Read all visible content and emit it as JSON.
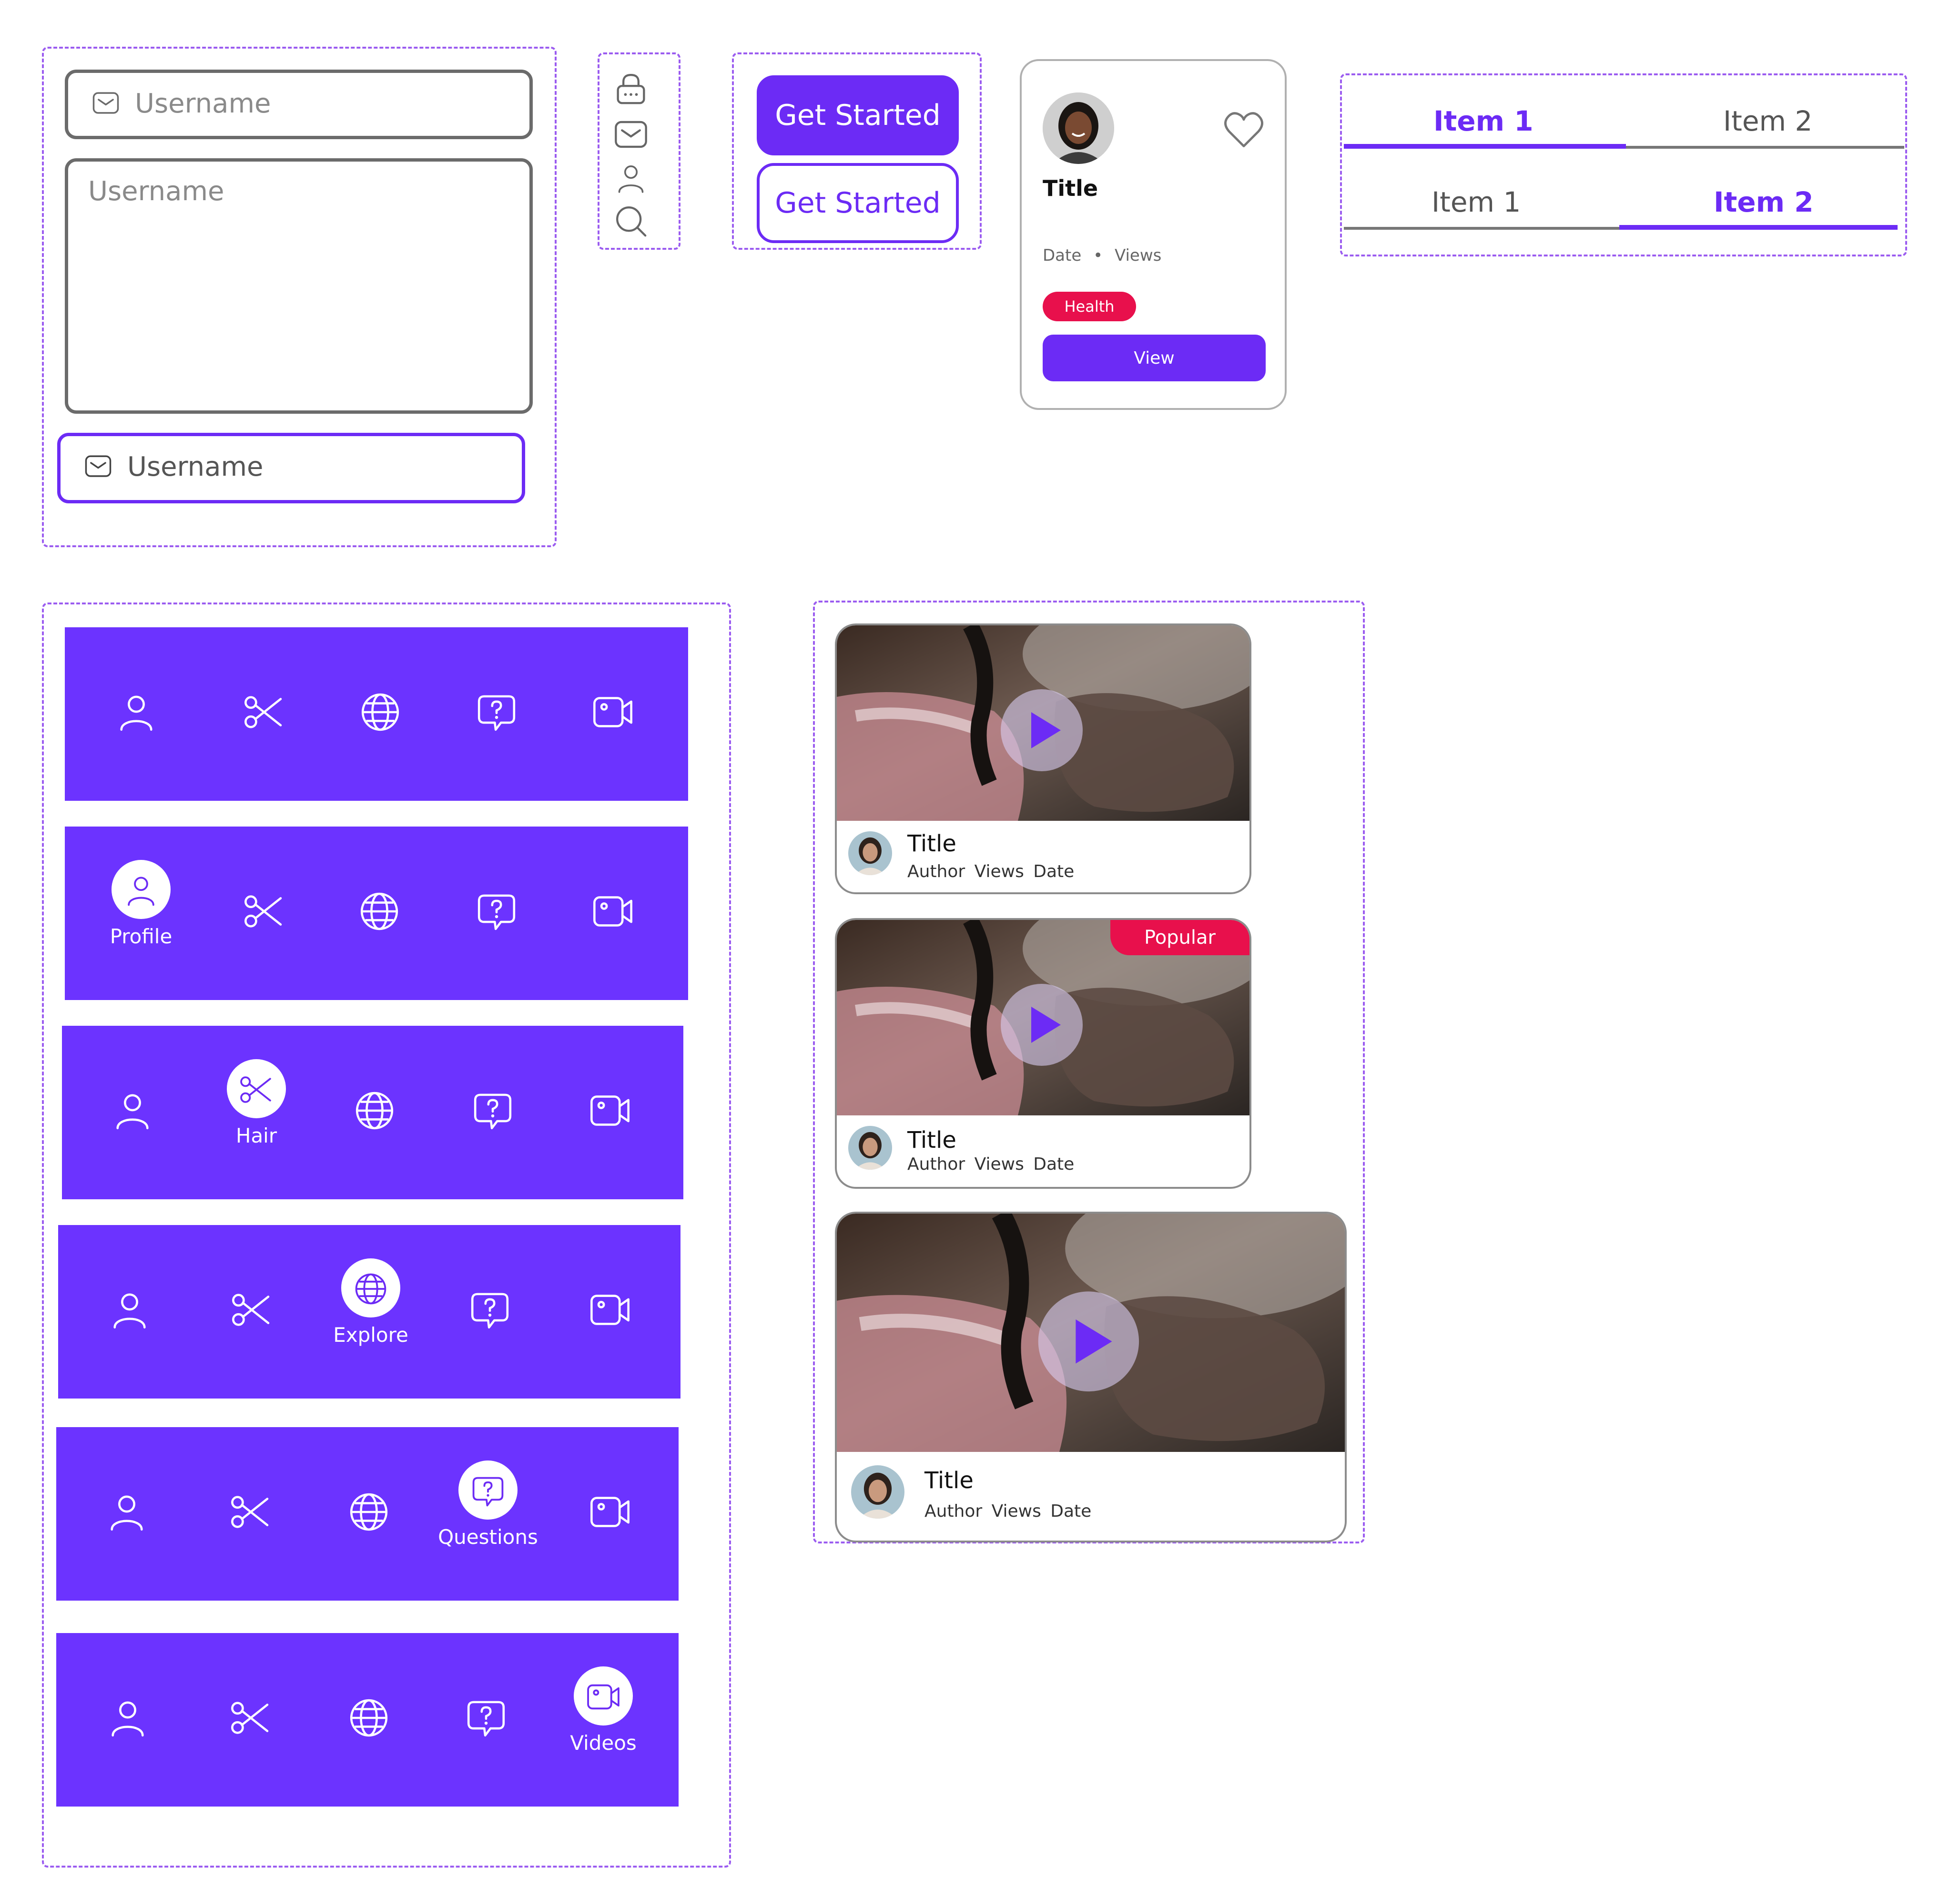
{
  "form": {
    "input_placeholder": "Username",
    "textarea_placeholder": "Username",
    "active_input_placeholder": "Username",
    "input_icon": "mail-icon"
  },
  "icon_column": [
    "lock-icon",
    "mail-icon",
    "user-icon",
    "search-icon"
  ],
  "buttons": {
    "primary_label": "Get Started",
    "secondary_label": "Get Started"
  },
  "product_card": {
    "title": "Title",
    "date": "Date",
    "separator": "•",
    "views": "Views",
    "tag": "Health",
    "action_label": "View"
  },
  "tabs": [
    {
      "items": [
        "Item 1",
        "Item 2"
      ],
      "active": 0
    },
    {
      "items": [
        "Item 1",
        "Item 2"
      ],
      "active": 1
    }
  ],
  "bottom_nav": {
    "icons": [
      "user-icon",
      "scissors-icon",
      "globe-icon",
      "question-chat-icon",
      "video-icon"
    ],
    "labels": [
      "Profile",
      "Hair",
      "Explore",
      "Questions",
      "Videos"
    ],
    "bars": [
      {
        "active": null
      },
      {
        "active": 0,
        "label": "Profile"
      },
      {
        "active": 1,
        "label": "Hair"
      },
      {
        "active": 2,
        "label": "Explore"
      },
      {
        "active": 3,
        "label": "Questions"
      },
      {
        "active": 4,
        "label": "Videos"
      }
    ]
  },
  "video_cards": [
    {
      "title": "Title",
      "meta": "Author  Views  Date"
    },
    {
      "title": "Title",
      "meta": "Author  Views  Date",
      "badge": "Popular"
    },
    {
      "title": "Title",
      "meta": "Author  Views  Date"
    }
  ],
  "colors": {
    "primary": "#6c2bf5",
    "nav_bg": "#6c33ff",
    "badge": "#e8104c",
    "dashed": "#9b5cf0"
  }
}
